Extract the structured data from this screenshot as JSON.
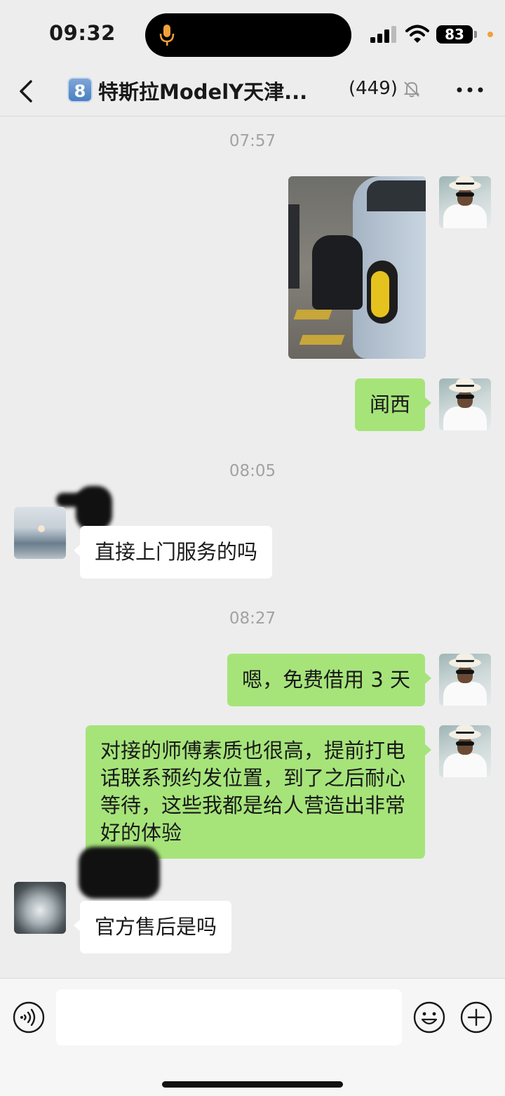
{
  "status_bar": {
    "time": "09:32",
    "battery": "83"
  },
  "header": {
    "badge": "8",
    "title": "特斯拉ModelY天津...",
    "member_count": "(449)"
  },
  "timestamps": [
    "07:57",
    "08:05",
    "08:27"
  ],
  "messages": [
    {
      "side": "self",
      "type": "image",
      "text": ""
    },
    {
      "side": "self",
      "type": "text",
      "text": "闻西"
    },
    {
      "side": "other",
      "type": "text",
      "text": "直接上门服务的吗"
    },
    {
      "side": "self",
      "type": "text",
      "text": "嗯，免费借用 3 天"
    },
    {
      "side": "self",
      "type": "text",
      "text": "对接的师傅素质也很高，提前打电话联系预约发位置，到了之后耐心等待，这些我都是给人营造出非常好的体验"
    },
    {
      "side": "other",
      "type": "text",
      "text": "官方售后是吗"
    }
  ],
  "input": {
    "value": "",
    "placeholder": ""
  },
  "colors": {
    "self_bubble": "#a6e47a",
    "other_bubble": "#ffffff",
    "background": "#ededed",
    "mic_accent": "#f2a03a"
  }
}
